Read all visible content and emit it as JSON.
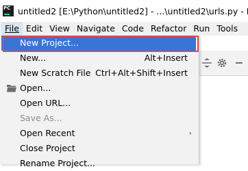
{
  "window": {
    "title": "untitled2 [E:\\Python\\untitled2] - ...\\untitled2\\urls.py - PyCh",
    "app_icon": "pycharm-icon"
  },
  "menubar": {
    "items": [
      "File",
      "Edit",
      "View",
      "Navigate",
      "Code",
      "Refactor",
      "Run",
      "Tools"
    ],
    "active": "File"
  },
  "file_menu": {
    "items": [
      {
        "label": "New Project...",
        "shortcut": "",
        "state": "selected"
      },
      {
        "label": "New...",
        "shortcut": "Alt+Insert",
        "state": "normal"
      },
      {
        "label": "New Scratch File",
        "shortcut": "Ctrl+Alt+Shift+Insert",
        "state": "normal"
      },
      {
        "label": "Open...",
        "shortcut": "",
        "state": "normal",
        "icon": "folder-icon"
      },
      {
        "label": "Open URL...",
        "shortcut": "",
        "state": "normal"
      },
      {
        "label": "Save As...",
        "shortcut": "",
        "state": "disabled"
      },
      {
        "label": "Open Recent",
        "shortcut": "",
        "state": "normal",
        "submenu": true
      },
      {
        "label": "Close Project",
        "shortcut": "",
        "state": "normal"
      },
      {
        "label": "Rename Project...",
        "shortcut": "",
        "state": "normal"
      }
    ]
  },
  "colors": {
    "selection": "#3875d7",
    "highlight_border": "#e0474c",
    "menu_bg": "#f2f2f2"
  }
}
